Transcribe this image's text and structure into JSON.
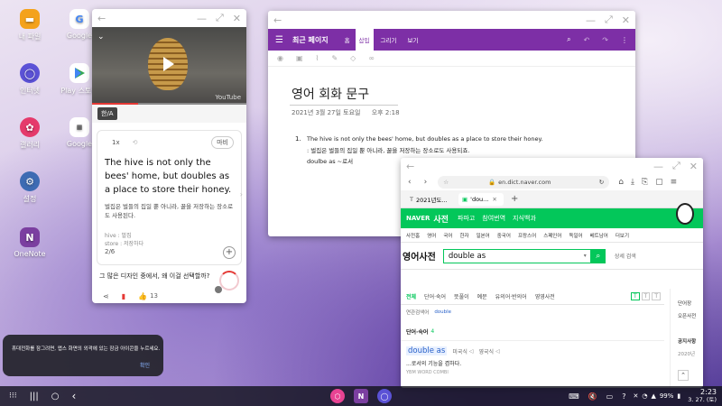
{
  "desktop": {
    "icons": [
      {
        "label": "내 파일",
        "icon": "folder-icon",
        "color": "#f4a21b"
      },
      {
        "label": "Google",
        "icon": "google-icon",
        "color": "#ffffff"
      },
      {
        "label": "인터넷",
        "icon": "internet-icon",
        "color": "#5b52d6"
      },
      {
        "label": "Play 스토어",
        "icon": "play-store-icon",
        "color": "#ffffff"
      },
      {
        "label": "갤러리",
        "icon": "gallery-icon",
        "color": "#e53a6b"
      },
      {
        "label": "Google",
        "icon": "google-folder-icon",
        "color": "#ffffff"
      },
      {
        "label": "설정",
        "icon": "settings-icon",
        "color": "#3d6bb3"
      },
      {
        "label": "OneNote",
        "icon": "onenote-icon",
        "color": "#7b3fa0"
      }
    ]
  },
  "video_window": {
    "video_label": "YouTube",
    "caption_badge": "한/A",
    "card": {
      "speed": "1x",
      "mode": "마비",
      "sentence": "The hive is not only the bees' home, but doubles as a place to store their honey.",
      "translation": "벌집은 벌들의 집일 뿐 아니라, 꿀을 저장하는 장소로도 사용된다.",
      "vocab": [
        "hive : 벌집",
        "store : 저장하다"
      ],
      "page": "2/6"
    },
    "question": "그 많은 디자인 중에서, 왜 이걸 선택할까?",
    "like_count": "13"
  },
  "onenote_window": {
    "section": "최근 페이지",
    "tabs": [
      "홈",
      "삽입",
      "그리기",
      "보기"
    ],
    "active_tab": "삽입",
    "page_title": "영어 회화 문구",
    "date": "2021년 3월 27일 토요일",
    "time": "오후 2:18",
    "list_number": "1.",
    "sentence": "The hive is not only the bees' home, but doubles as a place to store their honey.",
    "translation": ": 벌집은 벌들의 집일 뿐 아니라, 꿀을 저장하는 장소로도 사용되죠.",
    "note": "doulbe as ~로서"
  },
  "browser_window": {
    "url": "en.dict.naver.com",
    "tabs": [
      {
        "label": "2021년도..."
      },
      {
        "label": "'dou..."
      }
    ],
    "naver_logo": "NAVER",
    "service": "사전",
    "service_links": [
      "파파고",
      "참여번역",
      "지식백과"
    ],
    "dict_langs": [
      "사전홈",
      "영어",
      "국어",
      "한자",
      "일본어",
      "중국어",
      "프랑스어",
      "스페인어",
      "독일어",
      "베트남어",
      "더보기"
    ],
    "dict_title": "영어사전",
    "search_value": "double as",
    "search_link": "상세 검색",
    "result_tabs": [
      "전체",
      "단어·숙어",
      "뜻풀이",
      "예문",
      "유의어·반의어",
      "영영사전"
    ],
    "related_label": "연관검색어",
    "related_value": "double",
    "section_label": "단어·숙어",
    "section_count": "4",
    "entry_word": "double as",
    "entry_pron1": "미국식",
    "entry_pron2": "영국식",
    "entry_meaning": "...로서의 기능을 겸하다.",
    "entry_source": "YBM WORD COMBI",
    "side": [
      "단어장",
      "오픈사전",
      "공지사항",
      "2020년"
    ],
    "text_size_buttons": [
      "T",
      "T",
      "T"
    ]
  },
  "toast": {
    "text": "휴대전화를 잠그려면, 앱스 화면의 외곽에 있는 잠금 아이콘을 누르세요.",
    "action": "확인"
  },
  "taskbar": {
    "battery": "99%",
    "time": "2:23",
    "date": "3. 27. (토)"
  }
}
